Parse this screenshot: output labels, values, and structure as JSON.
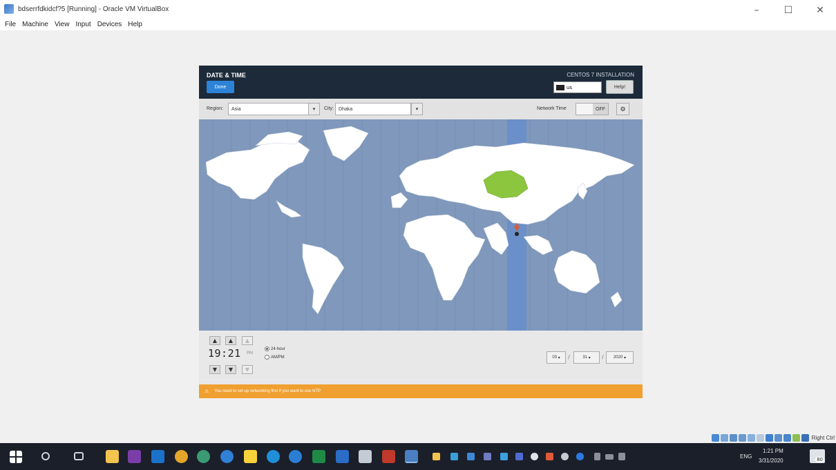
{
  "host_window": {
    "title": "bdserrfdkidcf?5 [Running] - Oracle VM VirtualBox",
    "controls": [
      "–",
      "☐",
      "✕"
    ],
    "menu": [
      "File",
      "Machine",
      "View",
      "Input",
      "Devices",
      "Help"
    ]
  },
  "installer": {
    "screen_title": "DATE & TIME",
    "done_label": "Done",
    "product": "CENTOS 7 INSTALLATION",
    "keyboard_layout": "us",
    "help_label": "Help!",
    "region_label": "Region:",
    "region_value": "Asia",
    "city_label": "City:",
    "city_value": "Dhaka",
    "network_time_label": "Network Time",
    "network_time_state": "OFF",
    "time": "19:21",
    "ampm": "PM",
    "format_24": "24-hour",
    "format_12": "AM/PM",
    "month": "03",
    "day": "31",
    "year": "2020",
    "warning": "You need to set up networking first if you want to use NTP",
    "colors": {
      "header": "#1c2a3a",
      "done_button": "#2d83d6",
      "ocean": "#7f98bb",
      "selected_zone": "#6a8fc9",
      "highlight_country": "#8cc63f",
      "warning": "#f0a030"
    }
  },
  "vm_status": {
    "host_key": "Right Ctrl"
  },
  "taskbar": {
    "icons": [
      "windows-start-icon",
      "search-icon",
      "task-view-icon",
      "file-explorer-icon",
      "onenote-icon",
      "outlook-icon",
      "chrome-icon",
      "edge-icon",
      "chrome-alt-icon",
      "sticky-notes-icon",
      "edge-blue-icon",
      "chrome-blue-icon",
      "excel-icon",
      "word-icon",
      "mail-icon",
      "filezilla-icon",
      "virtualbox-icon",
      "folder-icon",
      "network-icon",
      "settings-icon",
      "app-icon",
      "cloud-icon",
      "teams-icon",
      "chrome-small-icon",
      "paint-icon",
      "gear-small-icon",
      "bluetooth-icon"
    ],
    "language": "ENG",
    "clock_time": "1:21 PM",
    "clock_date": "3/31/2020",
    "notification_count": "80"
  }
}
